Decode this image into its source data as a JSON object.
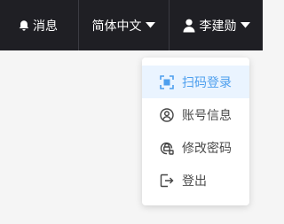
{
  "header": {
    "messages": {
      "label": "消息",
      "icon": "bell-icon"
    },
    "language": {
      "label": "简体中文",
      "icon": "caret-down-icon"
    },
    "user": {
      "name": "李建勋",
      "icon": "user-icon",
      "caret": "caret-down-icon"
    }
  },
  "dropdown": {
    "items": [
      {
        "label": "扫码登录",
        "icon": "scan-icon",
        "active": true
      },
      {
        "label": "账号信息",
        "icon": "account-icon",
        "active": false
      },
      {
        "label": "修改密码",
        "icon": "password-lock-icon",
        "active": false
      },
      {
        "label": "登出",
        "icon": "logout-icon",
        "active": false
      }
    ]
  },
  "colors": {
    "header_bg": "#1f1f24",
    "accent": "#4d9fee",
    "active_bg": "#eaf4ff",
    "page_bg": "#f5f5f5"
  }
}
